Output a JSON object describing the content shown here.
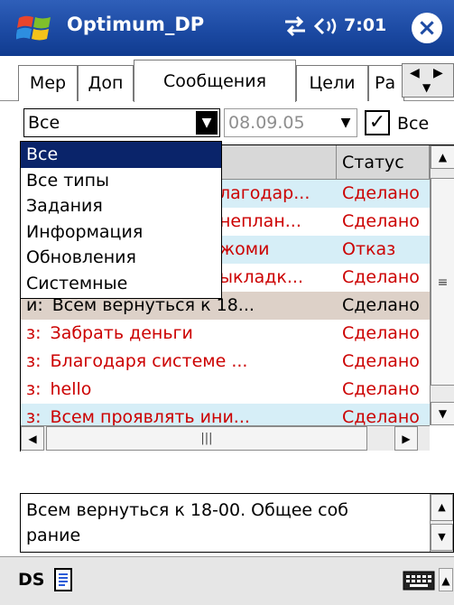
{
  "titlebar": {
    "app_title": "Optimum_DP",
    "time": "7:01",
    "close_glyph": "×"
  },
  "tabs": [
    {
      "label": "Мер"
    },
    {
      "label": "Доп"
    },
    {
      "label": "Сообщения"
    },
    {
      "label": "Цели"
    },
    {
      "label": "Ра"
    }
  ],
  "filter": {
    "type_value": "Все",
    "date_value": "08.09.05",
    "checkbox_label": "Все",
    "checkbox_checked": true
  },
  "grid": {
    "headers": {
      "message": "",
      "status": "Статус"
    },
    "rows": [
      {
        "prefix": "",
        "text": "лагодар...",
        "status": "Сделано",
        "color": "red"
      },
      {
        "prefix": "",
        "text": "неплан...",
        "status": "Сделано",
        "color": "red"
      },
      {
        "prefix": "",
        "text": "жоми",
        "status": "Отказ",
        "color": "red"
      },
      {
        "prefix": "",
        "text": "ыкладк...",
        "status": "Сделано",
        "color": "red"
      },
      {
        "prefix": "и:",
        "text": "Всем вернуться к 18...",
        "status": "Сделано",
        "color": "black"
      },
      {
        "prefix": "з:",
        "text": "Забрать деньги",
        "status": "Сделано",
        "color": "red"
      },
      {
        "prefix": "з:",
        "text": "Благодаря системе ...",
        "status": "Сделано",
        "color": "red"
      },
      {
        "prefix": "з:",
        "text": "hello",
        "status": "Сделано",
        "color": "red"
      },
      {
        "prefix": "з:",
        "text": "Всем проявлять ини...",
        "status": "Сделано",
        "color": "red"
      }
    ]
  },
  "dropdown": {
    "options": [
      "Все",
      "Все типы",
      "Задания",
      "Информация",
      "Обновления",
      "Системные"
    ],
    "selected_index": 0
  },
  "detail": {
    "text": "Всем вернуться к 18-00. Общее соб\nрание"
  },
  "bottombar": {
    "label": "DS"
  },
  "colors": {
    "title_blue": "#1c4aa3",
    "row_blue": "#d6eef7",
    "row_selected": "#ddd1c8",
    "status_red": "#cc0000",
    "dropdown_selected": "#0a246a"
  },
  "icons": [
    "windows-start-icon",
    "sync-icon",
    "speaker-icon",
    "close-icon",
    "document-icon",
    "keyboard-icon"
  ]
}
